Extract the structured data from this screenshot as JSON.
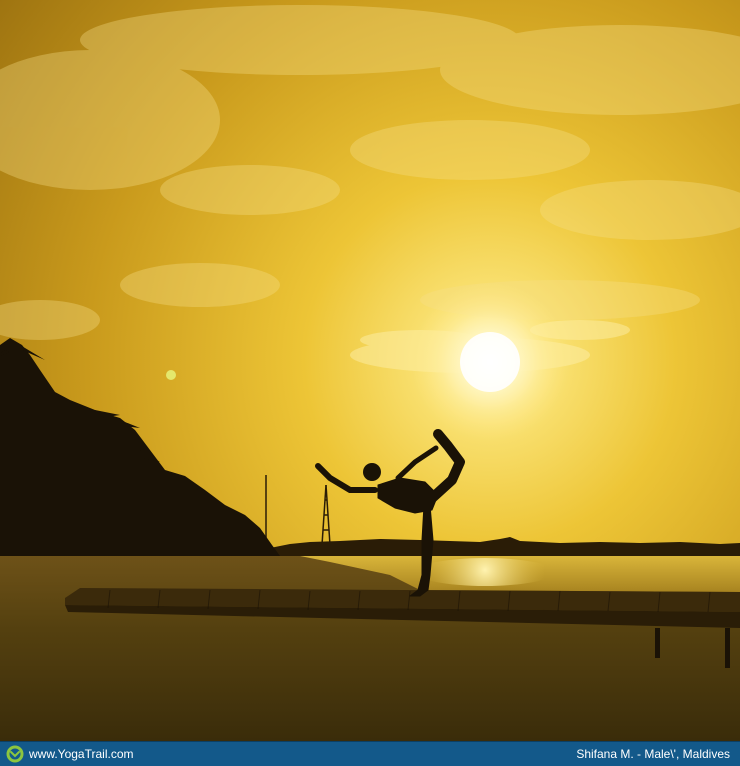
{
  "footer": {
    "site": "www.YogaTrail.com",
    "credit": "Shifana M. - Male\\', Maldives",
    "logo_icon": "yogatrail-logo-icon"
  },
  "colors": {
    "footer_bg": "#13598a",
    "sky_top": "#b8860b",
    "sky_glow": "#f2d13a",
    "sun": "#fff7c8",
    "silhouette": "#1a1206"
  }
}
